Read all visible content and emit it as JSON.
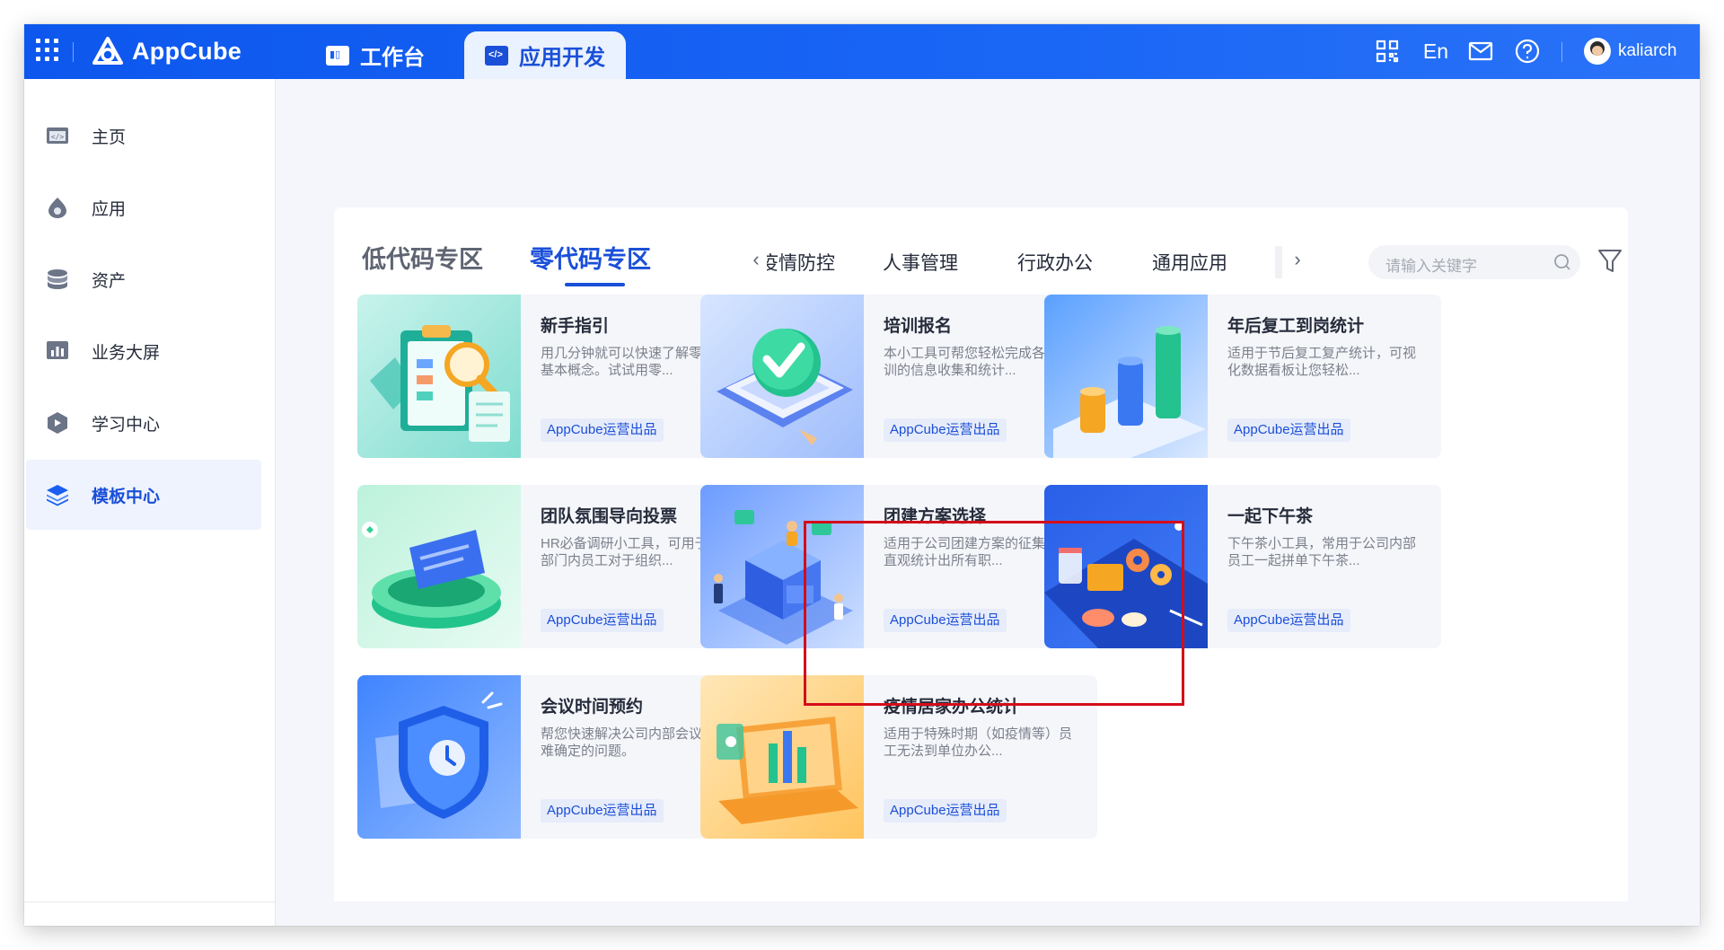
{
  "app": {
    "logo_text": "AppCube",
    "tabs": [
      {
        "label": "工作台"
      },
      {
        "label": "应用开发"
      }
    ],
    "lang_label": "En",
    "username": "kaliarch"
  },
  "sidebar": {
    "items": [
      {
        "label": "主页",
        "icon": "code-window-icon"
      },
      {
        "label": "应用",
        "icon": "app-drop-icon"
      },
      {
        "label": "资产",
        "icon": "database-icon"
      },
      {
        "label": "业务大屏",
        "icon": "bar-chart-icon"
      },
      {
        "label": "学习中心",
        "icon": "graduation-icon"
      },
      {
        "label": "模板中心",
        "icon": "layers-icon"
      }
    ],
    "active": "模板中心"
  },
  "main": {
    "zone_tabs": [
      {
        "label": "低代码专区"
      },
      {
        "label": "零代码专区"
      }
    ],
    "active_zone": "零代码专区",
    "categories": [
      "疫情防控",
      "人事管理",
      "行政办公",
      "通用应用"
    ],
    "search_placeholder": "请输入关键字",
    "cards": [
      {
        "title": "新手指引",
        "desc": "用几分钟就可以快速了解零码的基本概念。试试用零...",
        "badge": "AppCube运营出品"
      },
      {
        "title": "培训报名",
        "desc": "本小工具可帮您轻松完成各类培训的信息收集和统计...",
        "badge": "AppCube运营出品"
      },
      {
        "title": "年后复工到岗统计",
        "desc": "适用于节后复工复产统计，可视化数据看板让您轻松...",
        "badge": "AppCube运营出品"
      },
      {
        "title": "团队氛围导向投票",
        "desc": "HR必备调研小工具，可用于征集部门内员工对于组织...",
        "badge": "AppCube运营出品"
      },
      {
        "title": "团建方案选择",
        "desc": "适用于公司团建方案的征集，可直观统计出所有职...",
        "badge": "AppCube运营出品"
      },
      {
        "title": "一起下午茶",
        "desc": "下午茶小工具，常用于公司内部员工一起拼单下午茶...",
        "badge": "AppCube运营出品"
      },
      {
        "title": "会议时间预约",
        "desc": "帮您快速解决公司内部会议时间难确定的问题。",
        "badge": "AppCube运营出品"
      },
      {
        "title": "疫情居家办公统计",
        "desc": "适用于特殊时期（如疫情等）员工无法到单位办公...",
        "badge": "AppCube运营出品"
      }
    ],
    "highlighted_card": "团建方案选择"
  },
  "colors": {
    "brand": "#1a5ff2",
    "highlight_border": "#d40d1a"
  }
}
